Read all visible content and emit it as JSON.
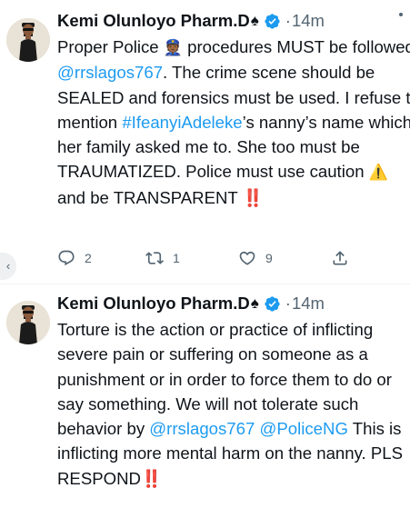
{
  "tweets": [
    {
      "author": {
        "display_name": "Kemi Olunloyo Pharm.D",
        "name_emoji": "♠",
        "verified": true
      },
      "separator": "·",
      "time": "14m",
      "text": {
        "t1": "Proper Police ",
        "emoji1": "👮🏾",
        "t2": " procedures MUST be followed ",
        "mention1": "@rrslagos767",
        "t3": ". The crime scene should be SEALED and forensics must be used. I refuse to mention ",
        "hashtag1": "#IfeanyiAdeleke",
        "t4": "’s nanny’s name which her family asked me to. She too must be TRAUMATIZED. Police must use caution ",
        "emoji2": "⚠️",
        "t5": " and be TRANSPARENT ",
        "emoji3": "‼️"
      },
      "actions": {
        "reply_count": "2",
        "retweet_count": "1",
        "like_count": "9",
        "reply_icon": "reply-icon",
        "retweet_icon": "retweet-icon",
        "like_icon": "like-icon",
        "share_icon": "share-icon"
      }
    },
    {
      "author": {
        "display_name": "Kemi Olunloyo Pharm.D",
        "name_emoji": "♠",
        "verified": true
      },
      "separator": "·",
      "time": "14m",
      "text": {
        "t1": "Torture is the action or practice of inflicting severe pain or suffering on someone as a punishment or in order to force them to do or say something. We will not tolerate such behavior by ",
        "mention1": "@rrslagos767",
        "t2": " ",
        "mention2": "@PoliceNG",
        "t3": " This is inflicting more mental harm on the nanny. PLS RESPOND",
        "emoji1": "‼️"
      }
    }
  ],
  "colors": {
    "text": "#0f1419",
    "secondary": "#536471",
    "link": "#1d9bf0",
    "verified": "#1d9bf0",
    "background": "#ffffff"
  }
}
